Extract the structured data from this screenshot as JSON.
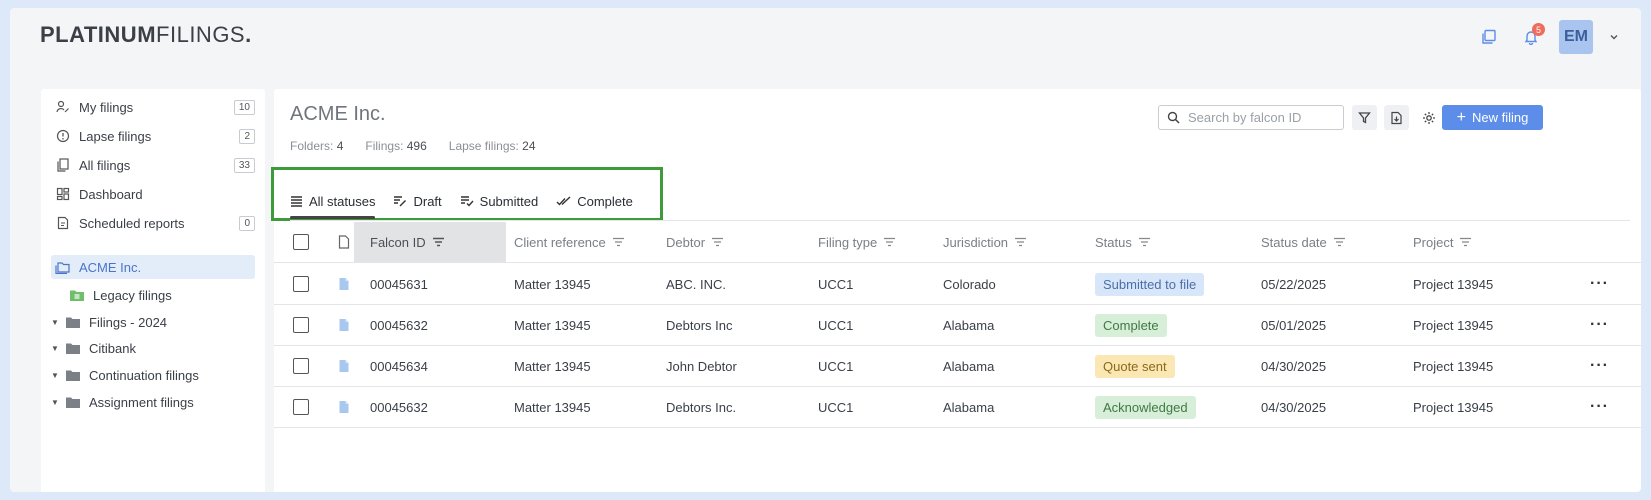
{
  "brand": {
    "part1": "PLATINUM",
    "part2": "FILINGS",
    "dot": "."
  },
  "header": {
    "notification_count": "5",
    "avatar_initials": "EM"
  },
  "sidebar": {
    "items": [
      {
        "label": "My filings",
        "count": "10"
      },
      {
        "label": "Lapse filings",
        "count": "2"
      },
      {
        "label": "All filings",
        "count": "33"
      },
      {
        "label": "Dashboard"
      },
      {
        "label": "Scheduled reports",
        "count": "0"
      }
    ],
    "active_folder": "ACME Inc.",
    "subfolders": [
      {
        "label": "Legacy filings"
      },
      {
        "label": "Filings - 2024"
      },
      {
        "label": "Citibank"
      },
      {
        "label": "Continuation filings"
      },
      {
        "label": "Assignment filings"
      }
    ]
  },
  "main": {
    "title": "ACME Inc.",
    "meta": {
      "folders_label": "Folders:",
      "folders_value": "4",
      "filings_label": "Filings:",
      "filings_value": "496",
      "lapse_label": "Lapse filings:",
      "lapse_value": "24"
    },
    "search_placeholder": "Search by falcon ID",
    "new_filing_label": "New filing",
    "tabs": [
      {
        "label": "All statuses"
      },
      {
        "label": "Draft"
      },
      {
        "label": "Submitted"
      },
      {
        "label": "Complete"
      }
    ],
    "columns": [
      "Falcon ID",
      "Client reference",
      "Debtor",
      "Filing type",
      "Jurisdiction",
      "Status",
      "Status date",
      "Project"
    ],
    "rows": [
      {
        "id": "00045631",
        "ref": "Matter 13945",
        "debtor": "ABC. INC.",
        "type": "UCC1",
        "jur": "Colorado",
        "status": "Submitted to file",
        "date": "05/22/2025",
        "project": "Project 13945"
      },
      {
        "id": "00045632",
        "ref": "Matter 13945",
        "debtor": "Debtors Inc",
        "type": "UCC1",
        "jur": "Alabama",
        "status": "Complete",
        "date": "05/01/2025",
        "project": "Project 13945"
      },
      {
        "id": "00045634",
        "ref": "Matter 13945",
        "debtor": "John Debtor",
        "type": "UCC1",
        "jur": "Alabama",
        "status": "Quote sent",
        "date": "04/30/2025",
        "project": "Project 13945"
      },
      {
        "id": "00045632",
        "ref": "Matter 13945",
        "debtor": "Debtors Inc.",
        "type": "UCC1",
        "jur": "Alabama",
        "status": "Acknowledged",
        "date": "04/30/2025",
        "project": "Project 13945"
      }
    ],
    "status_colors": {
      "Submitted to file": {
        "bg": "#d8e6fa",
        "fg": "#4a6fa8"
      },
      "Complete": {
        "bg": "#d7eed8",
        "fg": "#3f7a43"
      },
      "Quote sent": {
        "bg": "#fbe7b3",
        "fg": "#8a6a1a"
      },
      "Acknowledged": {
        "bg": "#d7eed8",
        "fg": "#3f7a43"
      }
    }
  }
}
